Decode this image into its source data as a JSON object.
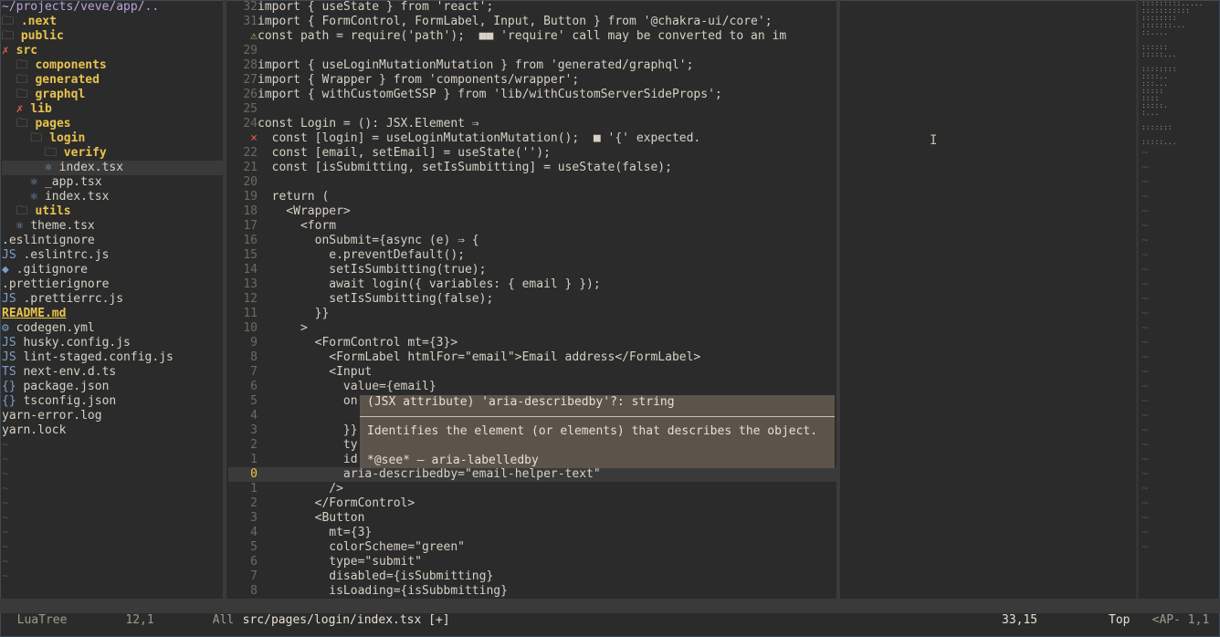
{
  "tree": {
    "root_path": "~/projects/veve/app/..",
    "items": [
      {
        "prefix": "🗀 ",
        "icon": "folder-icon",
        "label": ".next",
        "kind": "dir"
      },
      {
        "prefix": "🗀 ",
        "icon": "folder-icon",
        "label": "public",
        "kind": "dir"
      },
      {
        "prefix": "✗ ",
        "icon": "error-icon",
        "label": "src",
        "kind": "dir-err"
      },
      {
        "prefix": "  🗀 ",
        "icon": "folder-icon",
        "label": "components",
        "kind": "dir"
      },
      {
        "prefix": "  🗀 ",
        "icon": "folder-icon",
        "label": "generated",
        "kind": "dir"
      },
      {
        "prefix": "  🗀 ",
        "icon": "folder-icon",
        "label": "graphql",
        "kind": "dir"
      },
      {
        "prefix": "  ✗ ",
        "icon": "error-icon",
        "label": "lib",
        "kind": "dir-err"
      },
      {
        "prefix": "  🗀 ",
        "icon": "folder-icon",
        "label": "pages",
        "kind": "dir"
      },
      {
        "prefix": "    🗀 ",
        "icon": "folder-icon",
        "label": "login",
        "kind": "dir"
      },
      {
        "prefix": "      🗀 ",
        "icon": "folder-icon",
        "label": "verify",
        "kind": "dir"
      },
      {
        "prefix": "      ⚛ ",
        "icon": "react-icon",
        "label": "index.tsx",
        "kind": "file-sel"
      },
      {
        "prefix": "    ⚛ ",
        "icon": "react-icon",
        "label": "_app.tsx",
        "kind": "file"
      },
      {
        "prefix": "    ⚛ ",
        "icon": "react-icon",
        "label": "index.tsx",
        "kind": "file"
      },
      {
        "prefix": "  🗀 ",
        "icon": "folder-icon",
        "label": "utils",
        "kind": "dir"
      },
      {
        "prefix": "  ⚛ ",
        "icon": "react-icon",
        "label": "theme.tsx",
        "kind": "file"
      },
      {
        "prefix": "",
        "icon": "",
        "label": ".eslintignore",
        "kind": "file"
      },
      {
        "prefix": "JS ",
        "icon": "js-icon",
        "label": ".eslintrc.js",
        "kind": "file"
      },
      {
        "prefix": "◆ ",
        "icon": "git-icon",
        "label": ".gitignore",
        "kind": "file"
      },
      {
        "prefix": "",
        "icon": "",
        "label": ".prettierignore",
        "kind": "file"
      },
      {
        "prefix": "JS ",
        "icon": "js-icon",
        "label": ".prettierrc.js",
        "kind": "file"
      },
      {
        "prefix": "",
        "icon": "",
        "label": "README.md",
        "kind": "readme"
      },
      {
        "prefix": "⚙ ",
        "icon": "gear-icon",
        "label": "codegen.yml",
        "kind": "file"
      },
      {
        "prefix": "JS ",
        "icon": "js-icon",
        "label": "husky.config.js",
        "kind": "file"
      },
      {
        "prefix": "JS ",
        "icon": "js-icon",
        "label": "lint-staged.config.js",
        "kind": "file"
      },
      {
        "prefix": "TS ",
        "icon": "ts-icon",
        "label": "next-env.d.ts",
        "kind": "file"
      },
      {
        "prefix": "{} ",
        "icon": "json-icon",
        "label": "package.json",
        "kind": "file"
      },
      {
        "prefix": "{} ",
        "icon": "json-icon",
        "label": "tsconfig.json",
        "kind": "file"
      },
      {
        "prefix": "",
        "icon": "",
        "label": "yarn-error.log",
        "kind": "file"
      },
      {
        "prefix": "",
        "icon": "",
        "label": "yarn.lock",
        "kind": "file"
      }
    ]
  },
  "editor": {
    "lines": [
      {
        "n": "32",
        "t": "import { useState } from 'react';"
      },
      {
        "n": "31",
        "t": "import { FormControl, FormLabel, Input, Button } from '@chakra-ui/core';"
      },
      {
        "n": "⚠",
        "t": "const path = require('path');  ■■ 'require' call may be converted to an im"
      },
      {
        "n": "29",
        "t": ""
      },
      {
        "n": "28",
        "t": "import { useLoginMutationMutation } from 'generated/graphql';"
      },
      {
        "n": "27",
        "t": "import { Wrapper } from 'components/wrapper';"
      },
      {
        "n": "26",
        "t": "import { withCustomGetSSP } from 'lib/withCustomServerSideProps';"
      },
      {
        "n": "25",
        "t": ""
      },
      {
        "n": "24",
        "t": "const Login = (): JSX.Element ⇒"
      },
      {
        "n": "×",
        "t": "  const [login] = useLoginMutationMutation();  ■ '{' expected."
      },
      {
        "n": "22",
        "t": "  const [email, setEmail] = useState('');"
      },
      {
        "n": "21",
        "t": "  const [isSubmitting, setIsSumbitting] = useState(false);"
      },
      {
        "n": "20",
        "t": ""
      },
      {
        "n": "19",
        "t": "  return ("
      },
      {
        "n": "18",
        "t": "    <Wrapper>"
      },
      {
        "n": "17",
        "t": "      <form"
      },
      {
        "n": "16",
        "t": "        onSubmit={async (e) ⇒ {"
      },
      {
        "n": "15",
        "t": "          e.preventDefault();"
      },
      {
        "n": "14",
        "t": "          setIsSumbitting(true);"
      },
      {
        "n": "13",
        "t": "          await login({ variables: { email } });"
      },
      {
        "n": "12",
        "t": "          setIsSumbitting(false);"
      },
      {
        "n": "11",
        "t": "        }}"
      },
      {
        "n": "10",
        "t": "      >"
      },
      {
        "n": "9",
        "t": "        <FormControl mt={3}>"
      },
      {
        "n": "8",
        "t": "          <FormLabel htmlFor=\"email\">Email address</FormLabel>"
      },
      {
        "n": "7",
        "t": "          <Input"
      },
      {
        "n": "6",
        "t": "            value={email}"
      },
      {
        "n": "5",
        "t": "            on"
      },
      {
        "n": "4",
        "t": "              "
      },
      {
        "n": "3",
        "t": "            }}"
      },
      {
        "n": "2",
        "t": "            ty"
      },
      {
        "n": "1",
        "t": "            id"
      },
      {
        "n": "0",
        "t": "            aria-describedby=\"email-helper-text\""
      },
      {
        "n": "1",
        "t": "          />"
      },
      {
        "n": "2",
        "t": "        </FormControl>"
      },
      {
        "n": "3",
        "t": "        <Button"
      },
      {
        "n": "4",
        "t": "          mt={3}"
      },
      {
        "n": "5",
        "t": "          colorScheme=\"green\""
      },
      {
        "n": "6",
        "t": "          type=\"submit\""
      },
      {
        "n": "7",
        "t": "          disabled={isSubmitting}"
      },
      {
        "n": "8",
        "t": "          isLoading={isSubbmitting}"
      }
    ]
  },
  "hover": {
    "signature": "(JSX attribute) 'aria-describedby'?: string",
    "description": "Identifies the element (or elements) that describes the object.",
    "see": "*@see* — aria-labelledby"
  },
  "status": {
    "tree_name": "LuaTree",
    "tree_pos": "12,1",
    "tree_scroll": "All",
    "file_path": "src/pages/login/index.tsx [+]",
    "cursor_pos": "33,15",
    "scroll": "Top",
    "minimap_label": "<AP- 1,1"
  },
  "colors": {
    "background": "#2b2b2b",
    "directory": "#e8c34e",
    "error": "#e05a4a",
    "string": "#b8c25e",
    "keyword": "#e88a43"
  }
}
